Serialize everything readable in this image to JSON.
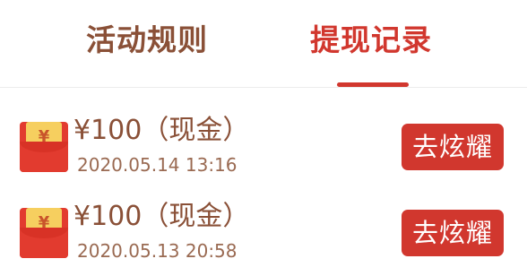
{
  "tabs": {
    "rules": "活动规则",
    "records": "提现记录",
    "active": "records"
  },
  "records": [
    {
      "icon": "red-envelope-icon",
      "envelope_symbol": "¥",
      "amount": "¥100（现金）",
      "timestamp": "2020.05.14 13:16",
      "button_label": "去炫耀"
    },
    {
      "icon": "red-envelope-icon",
      "envelope_symbol": "¥",
      "amount": "¥100（现金）",
      "timestamp": "2020.05.13 20:58",
      "button_label": "去炫耀"
    }
  ],
  "colors": {
    "accent": "#d1372e",
    "text_brown": "#8a5037",
    "envelope_red": "#e23b2f",
    "envelope_gold": "#f6cf5f"
  }
}
